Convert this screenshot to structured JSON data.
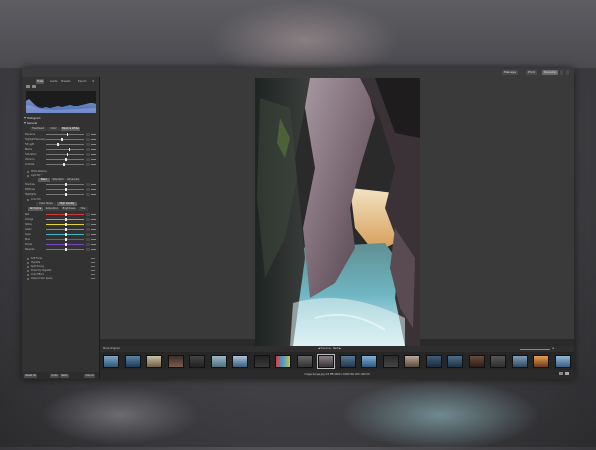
{
  "header": {
    "tabs": [
      {
        "label": "Manage",
        "active": false
      },
      {
        "label": "Print",
        "active": false
      },
      {
        "label": "Develop",
        "active": true
      }
    ]
  },
  "sidebar": {
    "tabs": [
      "Tools",
      "Guide",
      "Presets",
      "Export"
    ],
    "histogram_label": "Histogram",
    "sections": {
      "general": "General",
      "treatment": [
        "Treatment",
        "Color",
        "Black & White"
      ],
      "sliders": [
        "Exposure",
        "Highlight Recovery",
        "Fill Light",
        "Blacks",
        "Saturation",
        "Vibrance",
        "Contrast"
      ],
      "white_balance": "White Balance",
      "light_eq": "Light EQ™",
      "light_eq_tabs": [
        "Basic",
        "Standard",
        "Advanced"
      ],
      "light_eq_sliders": [
        "Shadows",
        "Midtones",
        "Highlights"
      ],
      "color_eq": "Color EQ",
      "color_eq_tabs": [
        "Color Mode",
        "High Quality"
      ],
      "color_eq_sub": [
        "All Colors",
        "Saturation",
        "Brightness",
        "Hue"
      ],
      "color_sliders": [
        "Red",
        "Orange",
        "Yellow",
        "Green",
        "Aqua",
        "Blue",
        "Purple",
        "Magenta"
      ],
      "modules": [
        "Soft Focus",
        "Vignette",
        "Split Toning",
        "Post-Crop Vignette",
        "Color Effect",
        "Output Color Space"
      ]
    },
    "bottom": {
      "reset": "Reset All",
      "undo": "Undo",
      "redo": "Redo",
      "cancel": "Cancel"
    }
  },
  "filmstrip": {
    "left_label": "Show Original",
    "center_label": "◀ Previous · Next ▶",
    "status": "Image-Gorge.jpg  4.8 MB  4000 x 6000  ISO 200  1/60  f/8"
  },
  "colors": {
    "accent": "#6a6a6a",
    "slider_colors": [
      "#d23b3b",
      "#e38a2c",
      "#e3d52c",
      "#47b547",
      "#3fb8c4",
      "#3b6ad2",
      "#7a45c9",
      "#c945b5"
    ]
  }
}
